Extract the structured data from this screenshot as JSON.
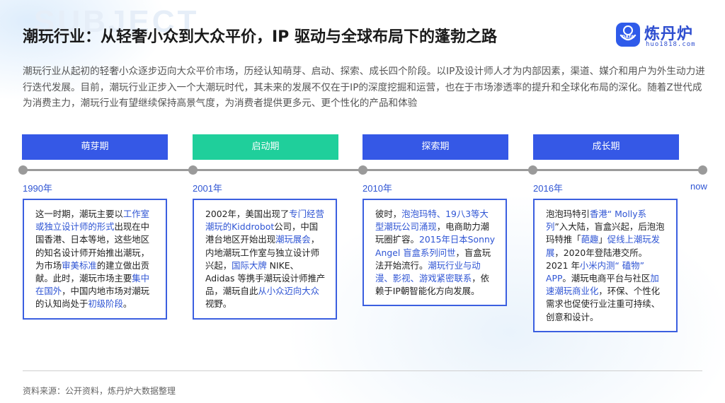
{
  "watermark": "SUBJECT",
  "title": "潮玩行业：从轻奢小众到大众平价，IP 驱动与全球布局下的蓬勃之路",
  "brand": {
    "name": "炼丹炉",
    "url": "huo1818.com",
    "mark_text": "DATA",
    "color": "#2f5bea"
  },
  "intro": "潮玩行业从起初的轻奢小众逐步迈向大众平价市场，历经认知萌芽、启动、探索、成长四个阶段。以IP及设计师人才为内部因素，渠道、媒介和用户为外生动力进行迭代发展。目前，潮玩行业正步入一个大潮玩时代，其未来的发展不仅在于IP的深度挖掘和运营，也在于市场渗透率的提升和全球化布局的深化。随着Z世代成为消费主力，潮玩行业有望继续保持高景气度，为消费者提供更多元、更个性化的产品和体验",
  "stages": [
    {
      "label": "萌芽期",
      "color": "#3558e6"
    },
    {
      "label": "启动期",
      "color": "#1fcf9b"
    },
    {
      "label": "探索期",
      "color": "#3558e6"
    },
    {
      "label": "成长期",
      "color": "#3558e6"
    }
  ],
  "years": [
    "1990年",
    "2001年",
    "2010年",
    "2016年",
    "now"
  ],
  "cards": [
    {
      "segments": [
        {
          "t": "这一时期，潮玩主要以",
          "h": false
        },
        {
          "t": "工作室或独立设计师的形式",
          "h": true
        },
        {
          "t": "出现在中国香港、日本等地，这些地区的知名设计师开始推出潮玩，为市场",
          "h": false
        },
        {
          "t": "审美标准",
          "h": true
        },
        {
          "t": "的建立做出贡献。此时，潮玩市场主要",
          "h": false
        },
        {
          "t": "集中在国外",
          "h": true
        },
        {
          "t": "，中国内地市场对潮玩的认知尚处于",
          "h": false
        },
        {
          "t": "初级阶段",
          "h": true
        },
        {
          "t": "。",
          "h": false
        }
      ]
    },
    {
      "segments": [
        {
          "t": "2002年，美国出现了",
          "h": false
        },
        {
          "t": "专门经营潮玩的Kiddrobot",
          "h": true
        },
        {
          "t": "公司，中国港台地区开始出现",
          "h": false
        },
        {
          "t": "潮玩展会",
          "h": true
        },
        {
          "t": "，内地潮玩工作室与独立设计师兴起，",
          "h": false
        },
        {
          "t": "国际大牌",
          "h": true
        },
        {
          "t": " NIKE、Adidas 等携手潮玩设计师推产品，潮玩自此",
          "h": false
        },
        {
          "t": "从小众迈向大众",
          "h": true
        },
        {
          "t": "视野。",
          "h": false
        }
      ]
    },
    {
      "segments": [
        {
          "t": "彼时，",
          "h": false
        },
        {
          "t": "泡泡玛特、19八3等大型潮玩公司涌现",
          "h": true
        },
        {
          "t": "，电商助力潮玩圈扩容。",
          "h": false
        },
        {
          "t": "2015年日本Sonny Angel 盲盒系列问世",
          "h": true
        },
        {
          "t": "，盲盒玩法开始流行。",
          "h": false
        },
        {
          "t": "潮玩行业与动漫、影视、游戏紧密联系",
          "h": true
        },
        {
          "t": "，依赖于IP朝智能化方向发展。",
          "h": false
        }
      ]
    },
    {
      "segments": [
        {
          "t": "泡泡玛特引",
          "h": false
        },
        {
          "t": "香港“ Molly系列",
          "h": true
        },
        {
          "t": "”入大陆，盲盒兴起，后泡泡玛特推「",
          "h": false
        },
        {
          "t": "葩趣",
          "h": true
        },
        {
          "t": "」",
          "h": false
        },
        {
          "t": "促线上潮玩发展",
          "h": true
        },
        {
          "t": "，2020年登陆港交所。2021 年",
          "h": false
        },
        {
          "t": "小米内测“ 磕物” APP",
          "h": true
        },
        {
          "t": "。潮玩电商平台与社区",
          "h": false
        },
        {
          "t": "加速潮玩商业化",
          "h": true
        },
        {
          "t": "，环保、个性化需求也促使行业注重可持续、创意和设计。",
          "h": false
        }
      ]
    }
  ],
  "source": "资料来源：公开资料，炼丹炉大数据整理"
}
